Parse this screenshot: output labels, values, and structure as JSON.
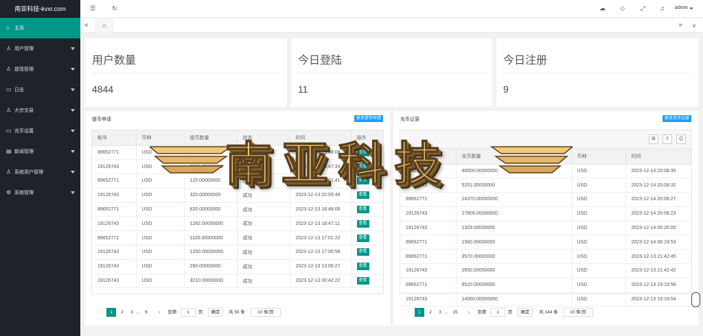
{
  "sidebar": {
    "logo": "南亚科技-kvxr.com",
    "items": [
      {
        "label": "主页",
        "icon": "⌂",
        "active": true,
        "caret": false
      },
      {
        "label": "用户管理",
        "icon": "♙",
        "caret": true
      },
      {
        "label": "提现管理",
        "icon": "♙",
        "caret": true
      },
      {
        "label": "日志",
        "icon": "▭",
        "caret": true
      },
      {
        "label": "大宗交易",
        "icon": "♙",
        "caret": true
      },
      {
        "label": "充币设置",
        "icon": "▭",
        "caret": true
      },
      {
        "label": "新闻管理",
        "icon": "▤",
        "caret": true
      },
      {
        "label": "系统用户管理",
        "icon": "♙",
        "caret": true
      },
      {
        "label": "系统管理",
        "icon": "⚙",
        "caret": true
      }
    ]
  },
  "header": {
    "user": "admin"
  },
  "stats": [
    {
      "label": "用户数量",
      "value": "4844"
    },
    {
      "label": "今日登陆",
      "value": "11"
    },
    {
      "label": "今日注册",
      "value": "9"
    }
  ],
  "withdraw": {
    "title": "提币申请",
    "more": "更多提币申请",
    "columns": [
      "帐号",
      "币种",
      "提币数量",
      "状态",
      "时间",
      "操作"
    ],
    "rows": [
      [
        "89652771",
        "USD",
        "1570.00000000",
        "成功",
        "2023-12-14 19:48:08",
        "查看"
      ],
      [
        "19126743",
        "USD",
        "2680.00000000",
        "成功",
        "2023-12-14 15:47:34",
        "查看"
      ],
      [
        "89652771",
        "USD",
        "120.00000000",
        "成功",
        "2023-12-13 21:01:41",
        "查看"
      ],
      [
        "19126743",
        "USD",
        "320.00000000",
        "成功",
        "2023-12-13 20:59:48",
        "查看"
      ],
      [
        "89652771",
        "USD",
        "820.00000000",
        "成功",
        "2023-12-13 18:48:06",
        "查看"
      ],
      [
        "19126743",
        "USD",
        "1282.00000000",
        "成功",
        "2023-12-13 18:47:11",
        "查看"
      ],
      [
        "89652771",
        "USD",
        "1105.00000000",
        "成功",
        "2023-12-13 17:01:22",
        "查看"
      ],
      [
        "19126743",
        "USD",
        "1250.00000000",
        "成功",
        "2023-12-13 17:00:58",
        "查看"
      ],
      [
        "19126743",
        "USD",
        "290.00000000",
        "成功",
        "2023-12-13 13:05:27",
        "查看"
      ],
      [
        "19126743",
        "USD",
        "3210.00000000",
        "成功",
        "2023-12-13 00:42:22",
        "查看"
      ]
    ],
    "pager": {
      "prev": "‹",
      "p1": "1",
      "p2": "2",
      "p3": "3",
      "dots": "...",
      "last": "6",
      "next": "›",
      "goto": "到第",
      "page_input": "1",
      "page_unit": "页",
      "confirm": "确定",
      "total": "共 55 条",
      "per_page": "10 条/页"
    }
  },
  "deposit": {
    "title": "充币记录",
    "more": "更多充币记录",
    "tools": [
      "⊞",
      "⇩",
      "⎙"
    ],
    "columns": [
      "帐号",
      "充币数量",
      "币种",
      "时间"
    ],
    "rows": [
      [
        "19126743",
        "40000.00000000",
        "USD",
        "2023-12-14 20:08:35"
      ],
      [
        "89652771",
        "5251.00000000",
        "USD",
        "2023-12-14 20:08:32"
      ],
      [
        "89652771",
        "24370.00000000",
        "USD",
        "2023-12-14 20:08:27"
      ],
      [
        "19126743",
        "27806.00000000",
        "USD",
        "2023-12-14 20:08:23"
      ],
      [
        "19126743",
        "1329.00000000",
        "USD",
        "2023-12-14 06:20:00"
      ],
      [
        "89652771",
        "1560.00000000",
        "USD",
        "2023-12-14 06:19:53"
      ],
      [
        "89652771",
        "3570.00000000",
        "USD",
        "2023-12-13 21:42:45"
      ],
      [
        "19126743",
        "2650.00000000",
        "USD",
        "2023-12-13 21:42:42"
      ],
      [
        "89652771",
        "9520.00000000",
        "USD",
        "2023-12-13 19:19:58"
      ],
      [
        "19126743",
        "14060.00000000",
        "USD",
        "2023-12-13 19:19:54"
      ]
    ],
    "pager": {
      "prev": "‹",
      "p1": "1",
      "p2": "2",
      "p3": "3",
      "dots": "...",
      "last": "15",
      "next": "›",
      "goto": "到第",
      "page_input": "1",
      "page_unit": "页",
      "confirm": "确定",
      "total": "共 144 条",
      "per_page": "10 条/页"
    }
  },
  "watermark": {
    "text": "南亚科技"
  },
  "colors": {
    "sidebar_bg": "#20222a",
    "accent": "#009688",
    "link_blue": "#1e9fff"
  }
}
